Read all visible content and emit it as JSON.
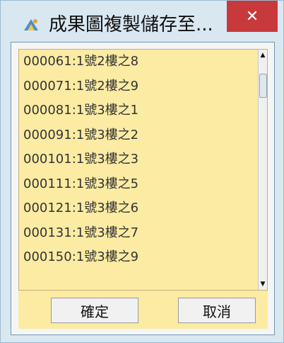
{
  "window": {
    "title": "成果圖複製儲存至...",
    "close_glyph": "✕",
    "app_icon": "app-icon"
  },
  "list": {
    "items": [
      "000061:1號2樓之8",
      "000071:1號2樓之9",
      "000081:1號3樓之1",
      "000091:1號3樓之2",
      "000101:1號3樓之3",
      "000111:1號3樓之5",
      "000121:1號3樓之6",
      "000131:1號3樓之7",
      "000150:1號3樓之9"
    ]
  },
  "buttons": {
    "ok_label": "確定",
    "cancel_label": "取消"
  },
  "colors": {
    "list_background": "#fbeba3",
    "close_background": "#c8393b",
    "frame_background": "#d9e7f1"
  }
}
